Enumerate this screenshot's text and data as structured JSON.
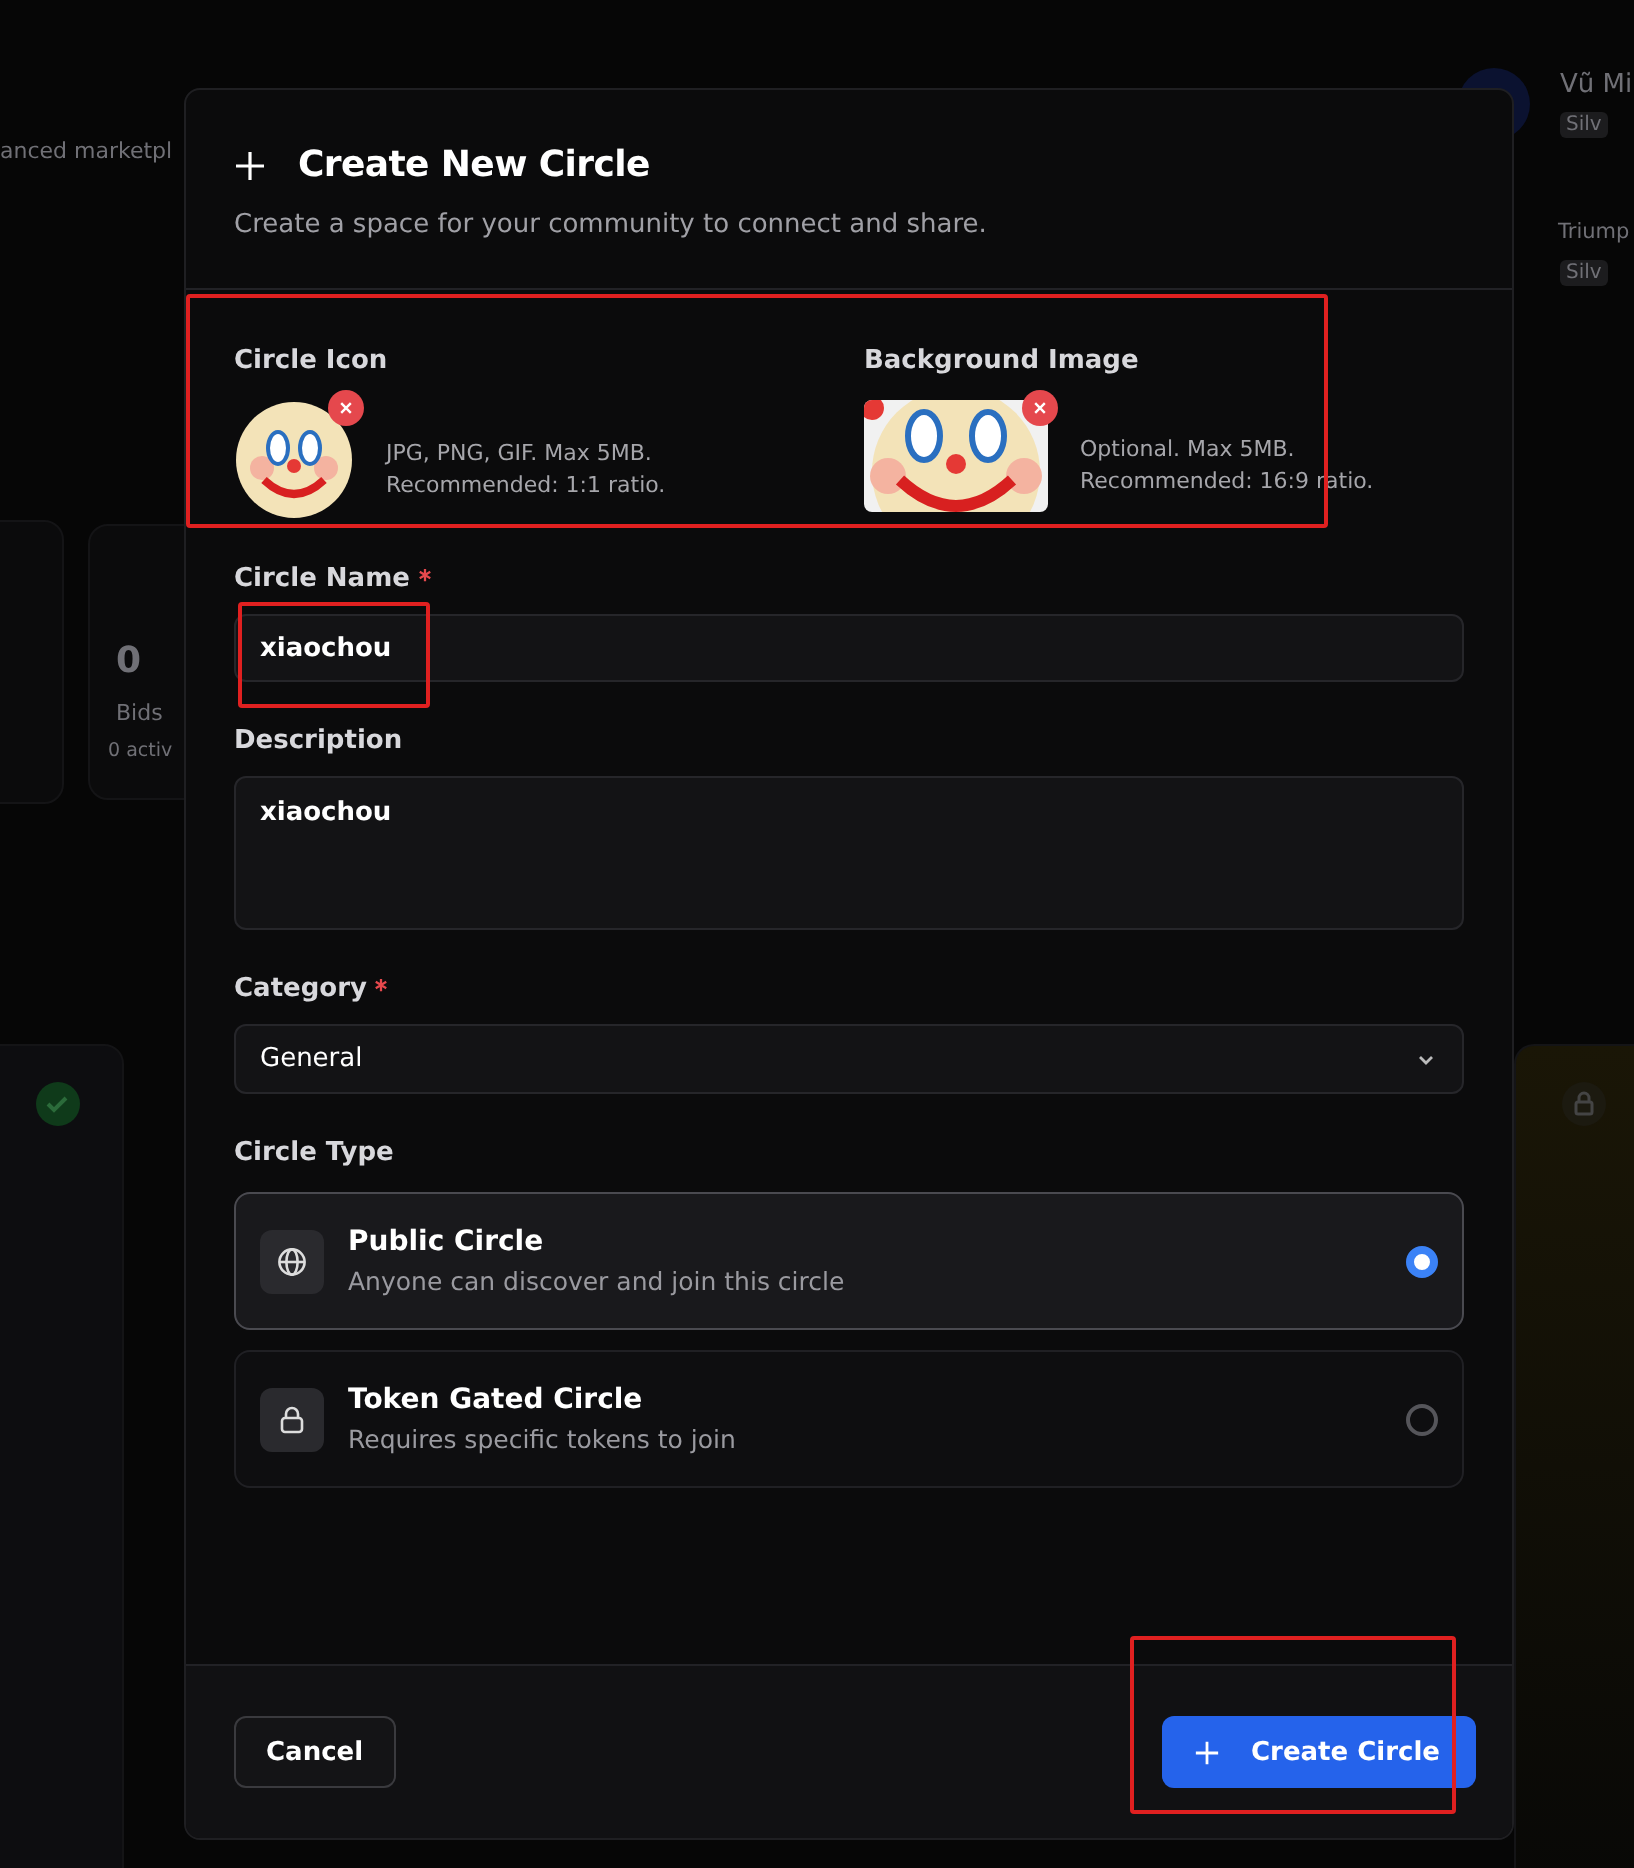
{
  "backdrop": {
    "texts": [
      {
        "kind": "tagline",
        "text": "anced marketpl"
      },
      {
        "kind": "user",
        "text": "Vũ Mi"
      },
      {
        "kind": "badge",
        "text": "Silv"
      },
      {
        "kind": "user2",
        "text": "Triump"
      },
      {
        "kind": "badge2",
        "text": "Silv"
      },
      {
        "kind": "stat",
        "text": "0"
      },
      {
        "kind": "statlabel",
        "text": "Bids"
      },
      {
        "kind": "statsub",
        "text": "0 activ"
      }
    ]
  },
  "dialog": {
    "title": "Create New Circle",
    "subtitle": "Create a space for your community to connect and share."
  },
  "uploads": {
    "highlighted": true,
    "items": [
      {
        "label": "Circle Icon",
        "kind": "round",
        "hint": [
          "JPG, PNG, GIF. Max 5MB.",
          "Recommended: 1:1 ratio."
        ]
      },
      {
        "label": "Background Image",
        "kind": "wide",
        "hint": [
          "Optional. Max 5MB.",
          "Recommended: 16:9 ratio."
        ]
      }
    ]
  },
  "name_field": {
    "label": "Circle Name",
    "required": true,
    "value": "xiaochou",
    "highlighted": true
  },
  "description_field": {
    "label": "Description",
    "value": "xiaochou"
  },
  "category_field": {
    "label": "Category",
    "required": true,
    "value": "General"
  },
  "circle_type": {
    "label": "Circle Type",
    "options": [
      {
        "kind": "globe",
        "title": "Public Circle",
        "description": "Anyone can discover and join this circle",
        "selected": true
      },
      {
        "kind": "lock",
        "title": "Token Gated Circle",
        "description": "Requires specific tokens to join",
        "selected": false
      }
    ]
  },
  "cancel_button": "Cancel",
  "create_button": {
    "label": "Create Circle",
    "highlighted": true
  }
}
